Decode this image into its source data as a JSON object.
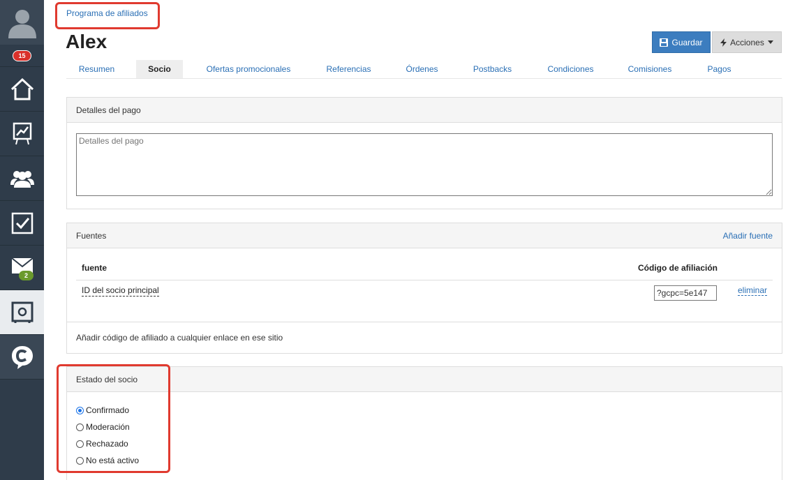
{
  "sidebar": {
    "items": [
      {
        "name": "avatar-icon"
      },
      {
        "badge": "15"
      },
      {
        "name": "home-icon"
      },
      {
        "name": "chart-icon"
      },
      {
        "name": "users-icon"
      },
      {
        "name": "tasks-icon"
      },
      {
        "name": "mail-icon",
        "badge": "2"
      },
      {
        "name": "safe-icon"
      },
      {
        "name": "brand-logo-icon"
      }
    ]
  },
  "breadcrumb": "Programa de afiliados",
  "title": "Alex",
  "buttons": {
    "save": "Guardar",
    "actions": "Acciones"
  },
  "tabs": [
    "Resumen",
    "Socio",
    "Ofertas promocionales",
    "Referencias",
    "Órdenes",
    "Postbacks",
    "Condiciones",
    "Comisiones",
    "Pagos"
  ],
  "active_tab": "Socio",
  "payment": {
    "title": "Detalles del pago",
    "placeholder": "Detalles del pago"
  },
  "sources": {
    "title": "Fuentes",
    "add_link": "Añadir fuente",
    "col_source": "fuente",
    "col_code": "Código de afiliación",
    "rows": [
      {
        "source": "ID del socio principal",
        "code": "?gcpc=5e147",
        "action": "eliminar"
      }
    ],
    "footer": "Añadir código de afiliado a cualquier enlace en ese sitio"
  },
  "status": {
    "title": "Estado del socio",
    "options": [
      "Confirmado",
      "Moderación",
      "Rechazado",
      "No está activo"
    ],
    "selected": "Confirmado"
  },
  "colors": {
    "sidebar": "#2f3c4a",
    "accent": "#3c7dbf",
    "highlight": "#e03a2f"
  }
}
